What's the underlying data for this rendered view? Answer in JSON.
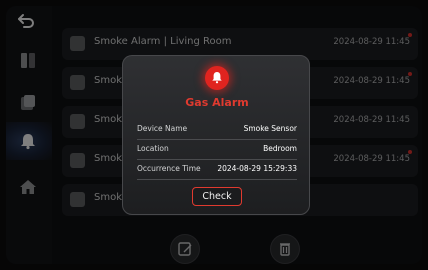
{
  "alarms": [
    {
      "title": "Smoke Alarm | Living Room",
      "time": "2024-08-29  11:45",
      "unread": true
    },
    {
      "title": "Smoke Alarm | Living Room",
      "time": "2024-08-29  11:45",
      "unread": true
    },
    {
      "title": "Smoke sensor",
      "time": "2024-08-29  11:45",
      "unread": false
    },
    {
      "title": "Smoke Alarm | Living Room",
      "time": "2024-08-29  11:45",
      "unread": true
    },
    {
      "title": "Smoke sensor",
      "time": "",
      "unread": false
    }
  ],
  "dialog": {
    "title": "Gas Alarm",
    "fields": [
      {
        "label": "Device Name",
        "value": "Smoke Sensor"
      },
      {
        "label": "Location",
        "value": "Bedroom"
      },
      {
        "label": "Occurrence Time",
        "value": "2024-08-29 15:29:33"
      }
    ],
    "check_label": "Check"
  },
  "colors": {
    "accent": "#e0241f",
    "active_nav": "#2b3c5c"
  },
  "icons": {
    "back": "back-arrow-icon",
    "nav": [
      "door-icon",
      "device-icon",
      "alarm-bell-icon",
      "home-icon"
    ],
    "bottom": [
      "edit-icon",
      "delete-icon"
    ]
  }
}
